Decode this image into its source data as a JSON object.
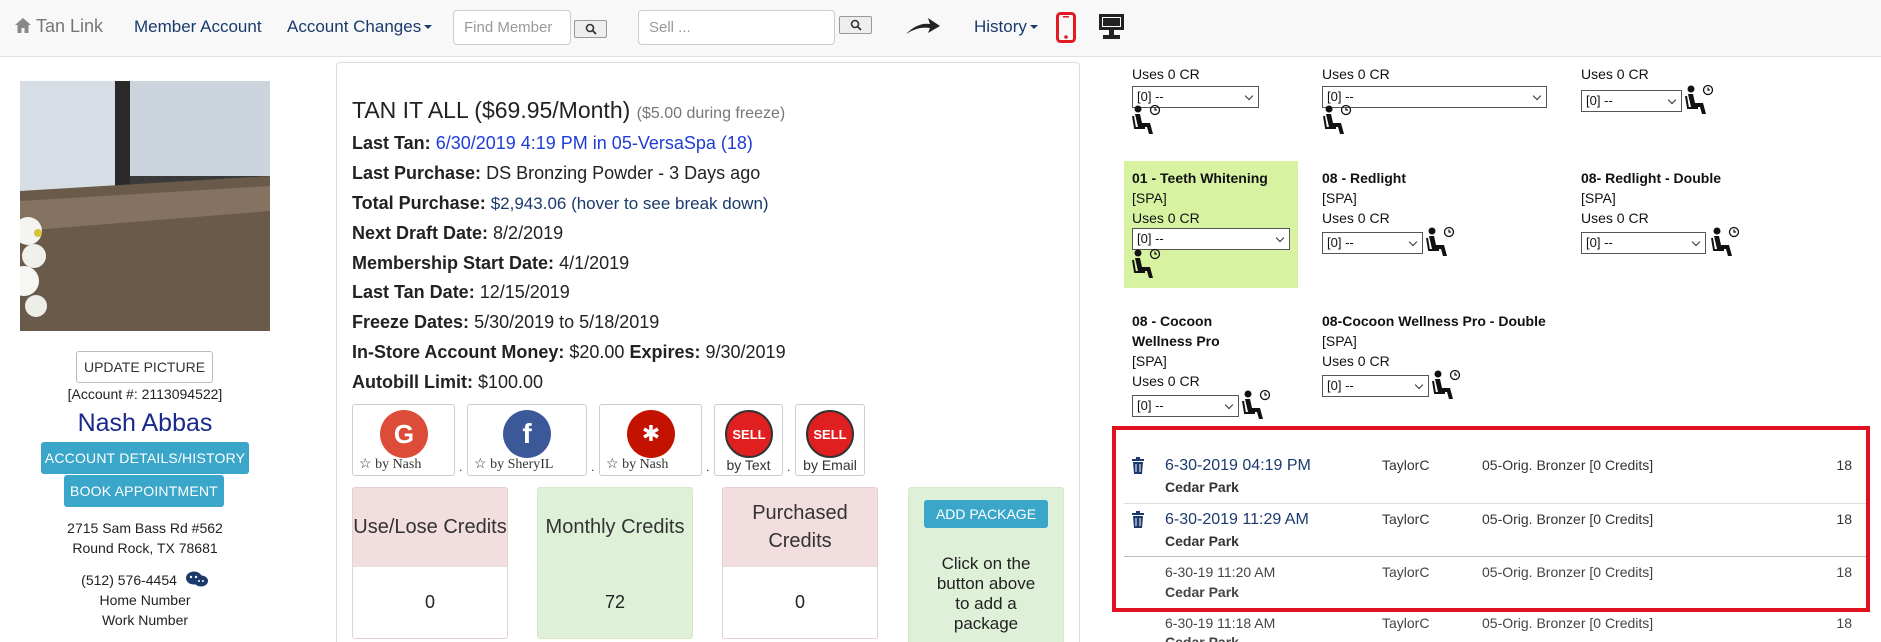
{
  "nav": {
    "brand": "Tan Link",
    "member_account": "Member Account",
    "account_changes": "Account Changes",
    "find_member_placeholder": "Find Member",
    "sell_placeholder": "Sell ...",
    "history": "History"
  },
  "profile": {
    "update_picture": "UPDATE PICTURE",
    "account_number": "[Account #: 2113094522]",
    "name": "Nash Abbas",
    "details_button": "ACCOUNT DETAILS/HISTORY",
    "book_button": "BOOK APPOINTMENT",
    "address_line1": "2715 Sam Bass Rd #562",
    "address_line2": "Round Rock, TX 78681",
    "phone": "(512) 576-4454",
    "home_number": "Home Number",
    "work_number": "Work Number"
  },
  "membership": {
    "plan": "TAN IT ALL ($69.95/Month)",
    "plan_note": "($5.00 during freeze)",
    "last_tan_label": "Last Tan:",
    "last_tan_value": "6/30/2019 4:19 PM in 05-VersaSpa (18)",
    "last_purchase_label": "Last Purchase:",
    "last_purchase_value": "DS Bronzing Powder - 3 Days ago",
    "total_purchase_label": "Total Purchase:",
    "total_purchase_value": "$2,943.06 (hover to see break down)",
    "next_draft_label": "Next Draft Date:",
    "next_draft_value": "8/2/2019",
    "start_label": "Membership Start Date:",
    "start_value": "4/1/2019",
    "last_tan_date_label": "Last Tan Date:",
    "last_tan_date_value": "12/15/2019",
    "freeze_label": "Freeze Dates:",
    "freeze_value": "5/30/2019 to 5/18/2019",
    "money_label": "In-Store Account Money:",
    "money_value": "$20.00",
    "expires_label": "Expires:",
    "expires_value": "9/30/2019",
    "autobill_label": "Autobill Limit:",
    "autobill_value": "$100.00"
  },
  "reviews": [
    {
      "icon": "G",
      "label": "by   Nash",
      "color": "#dd4b39"
    },
    {
      "icon": "f",
      "label": "by   SheryIL",
      "color": "#3b5998"
    },
    {
      "icon": "y",
      "label": "by   Nash",
      "color": "#c41200"
    },
    {
      "icon": "SELL",
      "label": "by Text",
      "color": "#e02020"
    },
    {
      "icon": "SELL",
      "label": "by Email",
      "color": "#e02020"
    }
  ],
  "credits": {
    "use_lose_label": "Use/Lose Credits",
    "use_lose_value": "0",
    "monthly_label": "Monthly Credits",
    "monthly_value": "72",
    "purchased_label": "Purchased Credits",
    "purchased_value": "0",
    "add_package": "ADD PACKAGE",
    "add_package_note": "Click on the button above to add a package"
  },
  "services": {
    "uses_0": "Uses 0 CR",
    "select_default": "[0] --",
    "spa": "[SPA]",
    "teeth": "01 - Teeth Whitening",
    "redlight": "08 - Redlight",
    "redlight_double": "08- Redlight - Double",
    "cocoon": "08 - Cocoon Wellness Pro",
    "cocoon_double": "08-Cocoon Wellness Pro - Double"
  },
  "history": [
    {
      "date": "6-30-2019 04:19 PM",
      "location": "Cedar Park",
      "user": "TaylorC",
      "desc": "05-Orig. Bronzer [0 Credits]",
      "num": "18",
      "voided": false
    },
    {
      "date": "6-30-2019 11:29 AM",
      "location": "Cedar Park",
      "user": "TaylorC",
      "desc": "05-Orig. Bronzer [0 Credits]",
      "num": "18",
      "voided": false
    },
    {
      "date": "6-30-19 11:20 AM",
      "location": "Cedar Park",
      "user": "TaylorC",
      "desc": "05-Orig. Bronzer [0 Credits]",
      "num": "18",
      "voided": true
    },
    {
      "date": "6-30-19 11:18 AM",
      "location": "Cedar Park",
      "user": "TaylorC",
      "desc": "05-Orig. Bronzer [0 Credits]",
      "num": "18",
      "voided": true
    }
  ]
}
